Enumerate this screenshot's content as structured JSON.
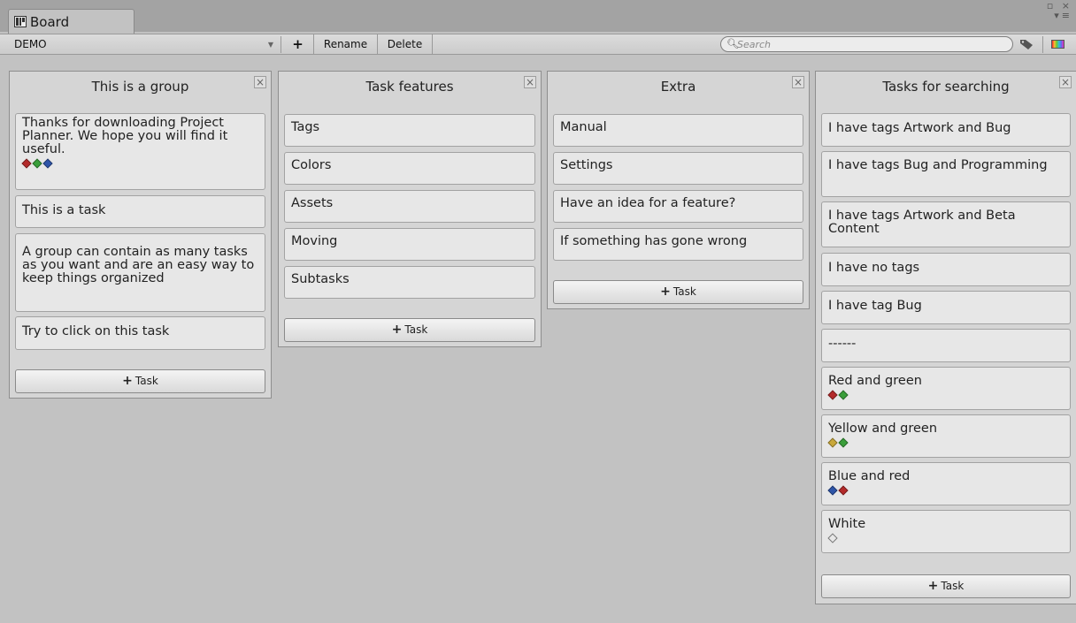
{
  "window": {
    "tab_title": "Board",
    "tab_icon": "board-icon",
    "controls": [
      "▫ ×",
      "▾≡"
    ]
  },
  "toolbar": {
    "board_select_value": "DEMO",
    "add_label": "+",
    "rename_label": "Rename",
    "delete_label": "Delete",
    "search_placeholder": "Search",
    "search_value": ""
  },
  "add_task_label": "Task",
  "tag_colors": {
    "red": "#b32a2a",
    "green": "#3a9e3a",
    "blue": "#2f55a8",
    "yellow": "#c9a83a",
    "white": "#e8e8e8"
  },
  "groups": [
    {
      "title": "This is a group",
      "tasks": [
        {
          "text": "Thanks for downloading Project Planner. We hope you will find it useful.",
          "tags": [
            "red",
            "green",
            "blue"
          ]
        },
        {
          "text": "This is a task",
          "tags": []
        },
        {
          "text": "A group can contain as many tasks as you want and are an easy way to keep things organized",
          "tags": []
        },
        {
          "text": "Try to click on this task",
          "tags": []
        }
      ]
    },
    {
      "title": "Task features",
      "tasks": [
        {
          "text": "Tags",
          "tags": []
        },
        {
          "text": "Colors",
          "tags": []
        },
        {
          "text": "Assets",
          "tags": []
        },
        {
          "text": "Moving",
          "tags": []
        },
        {
          "text": "Subtasks",
          "tags": []
        }
      ]
    },
    {
      "title": "Extra",
      "tasks": [
        {
          "text": "Manual",
          "tags": []
        },
        {
          "text": "Settings",
          "tags": []
        },
        {
          "text": "Have an idea for a feature?",
          "tags": []
        },
        {
          "text": "If something has gone wrong",
          "tags": []
        }
      ]
    },
    {
      "title": "Tasks for searching",
      "tasks": [
        {
          "text": "I have tags Artwork and Bug",
          "tags": []
        },
        {
          "text": "I have tags Bug and Programming",
          "tags": []
        },
        {
          "text": "I have tags Artwork and Beta Content",
          "tags": []
        },
        {
          "text": "I have no tags",
          "tags": []
        },
        {
          "text": "I have tag Bug",
          "tags": []
        },
        {
          "text": "------",
          "tags": []
        },
        {
          "text": "Red and green",
          "tags": [
            "red",
            "green"
          ]
        },
        {
          "text": "Yellow and green",
          "tags": [
            "yellow",
            "green"
          ]
        },
        {
          "text": "Blue and red",
          "tags": [
            "blue",
            "red"
          ]
        },
        {
          "text": "White",
          "tags": [
            "white"
          ]
        }
      ]
    }
  ]
}
